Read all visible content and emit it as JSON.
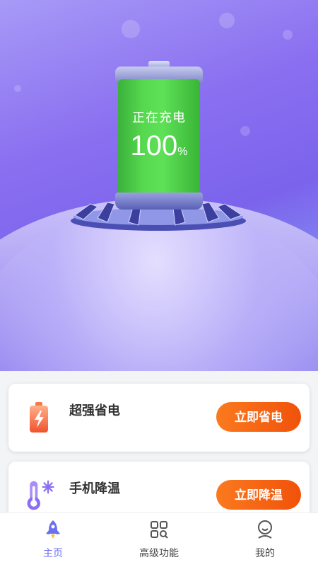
{
  "hero": {
    "battery_status": "正在充电",
    "battery_percent": "100",
    "battery_unit": "%"
  },
  "cards": [
    {
      "title": "超强省电",
      "action_label": "立即省电",
      "icon": "battery-charging-icon"
    },
    {
      "title": "手机降温",
      "action_label": "立即降温",
      "icon": "thermometer-snowflake-icon"
    }
  ],
  "tabs": [
    {
      "label": "主页",
      "icon": "rocket-icon",
      "active": true
    },
    {
      "label": "高级功能",
      "icon": "grid-search-icon",
      "active": false
    },
    {
      "label": "我的",
      "icon": "profile-icon",
      "active": false
    }
  ],
  "colors": {
    "accent": "#6b6ff0",
    "button_orange": "#f0520a",
    "battery_green": "#56d84f"
  }
}
